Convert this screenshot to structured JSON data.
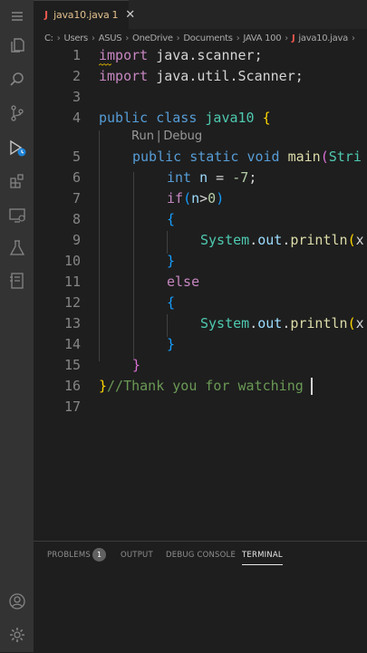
{
  "tab": {
    "icon_letter": "J",
    "filename": "java10.java",
    "number": "1",
    "close": "✕"
  },
  "breadcrumb": {
    "parts": [
      "C:",
      "Users",
      "ASUS",
      "OneDrive",
      "Documents",
      "JAVA 100"
    ],
    "file_icon": "J",
    "file": "java10.java",
    "trail": "›"
  },
  "codelens": {
    "run": "Run",
    "sep": "|",
    "debug": "Debug"
  },
  "line_numbers": [
    "1",
    "2",
    "3",
    "4",
    "5",
    "6",
    "7",
    "8",
    "9",
    "10",
    "11",
    "12",
    "13",
    "14",
    "15",
    "16",
    "17"
  ],
  "code": {
    "l1": {
      "kw": "import",
      "rest": " java.scanner;"
    },
    "l2": {
      "kw": "import",
      "rest": " java.util.Scanner;"
    },
    "l4": {
      "kw1": "public",
      "kw2": "class",
      "name": "java10",
      "brace": "{"
    },
    "l5": {
      "kw1": "public",
      "kw2": "static",
      "kw3": "void",
      "fn": "main",
      "paren": "(",
      "arg": "Stri"
    },
    "l6": {
      "type": "int",
      "var": "n",
      "op": " = ",
      "num": "-7",
      "end": ";"
    },
    "l7": {
      "kw": "if",
      "p1": "(",
      "var": "n",
      "op": ">",
      "num": "0",
      "p2": ")"
    },
    "l8": {
      "brace": "{"
    },
    "l9": {
      "type": "System",
      "dot1": ".",
      "var": "out",
      "dot2": ".",
      "fn": "println",
      "paren": "(",
      "arg": "x"
    },
    "l10": {
      "brace": "}"
    },
    "l11": {
      "kw": "else"
    },
    "l12": {
      "brace": "{"
    },
    "l13": {
      "type": "System",
      "dot1": ".",
      "var": "out",
      "dot2": ".",
      "fn": "println",
      "paren": "(",
      "arg": "x"
    },
    "l14": {
      "brace": "}"
    },
    "l15": {
      "brace": "}"
    },
    "l16": {
      "brace": "}",
      "comment": "//Thank you for watching"
    }
  },
  "panel": {
    "problems": "PROBLEMS",
    "problems_count": "1",
    "output": "OUTPUT",
    "debug_console": "DEBUG CONSOLE",
    "terminal": "TERMINAL"
  },
  "colors": {
    "keyword": "#569cd6",
    "control": "#c586c0",
    "type": "#4ec9b0",
    "function": "#dcdcaa",
    "variable": "#9cdcfe",
    "number": "#b5cea8",
    "comment": "#6a9955",
    "tab_file": "#e2c08d"
  },
  "activity_icons": [
    "menu-icon",
    "explorer-icon",
    "search-icon",
    "source-control-icon",
    "run-debug-icon",
    "extensions-icon",
    "remote-explorer-icon",
    "testing-icon",
    "notebook-icon",
    "account-icon",
    "settings-gear-icon"
  ]
}
